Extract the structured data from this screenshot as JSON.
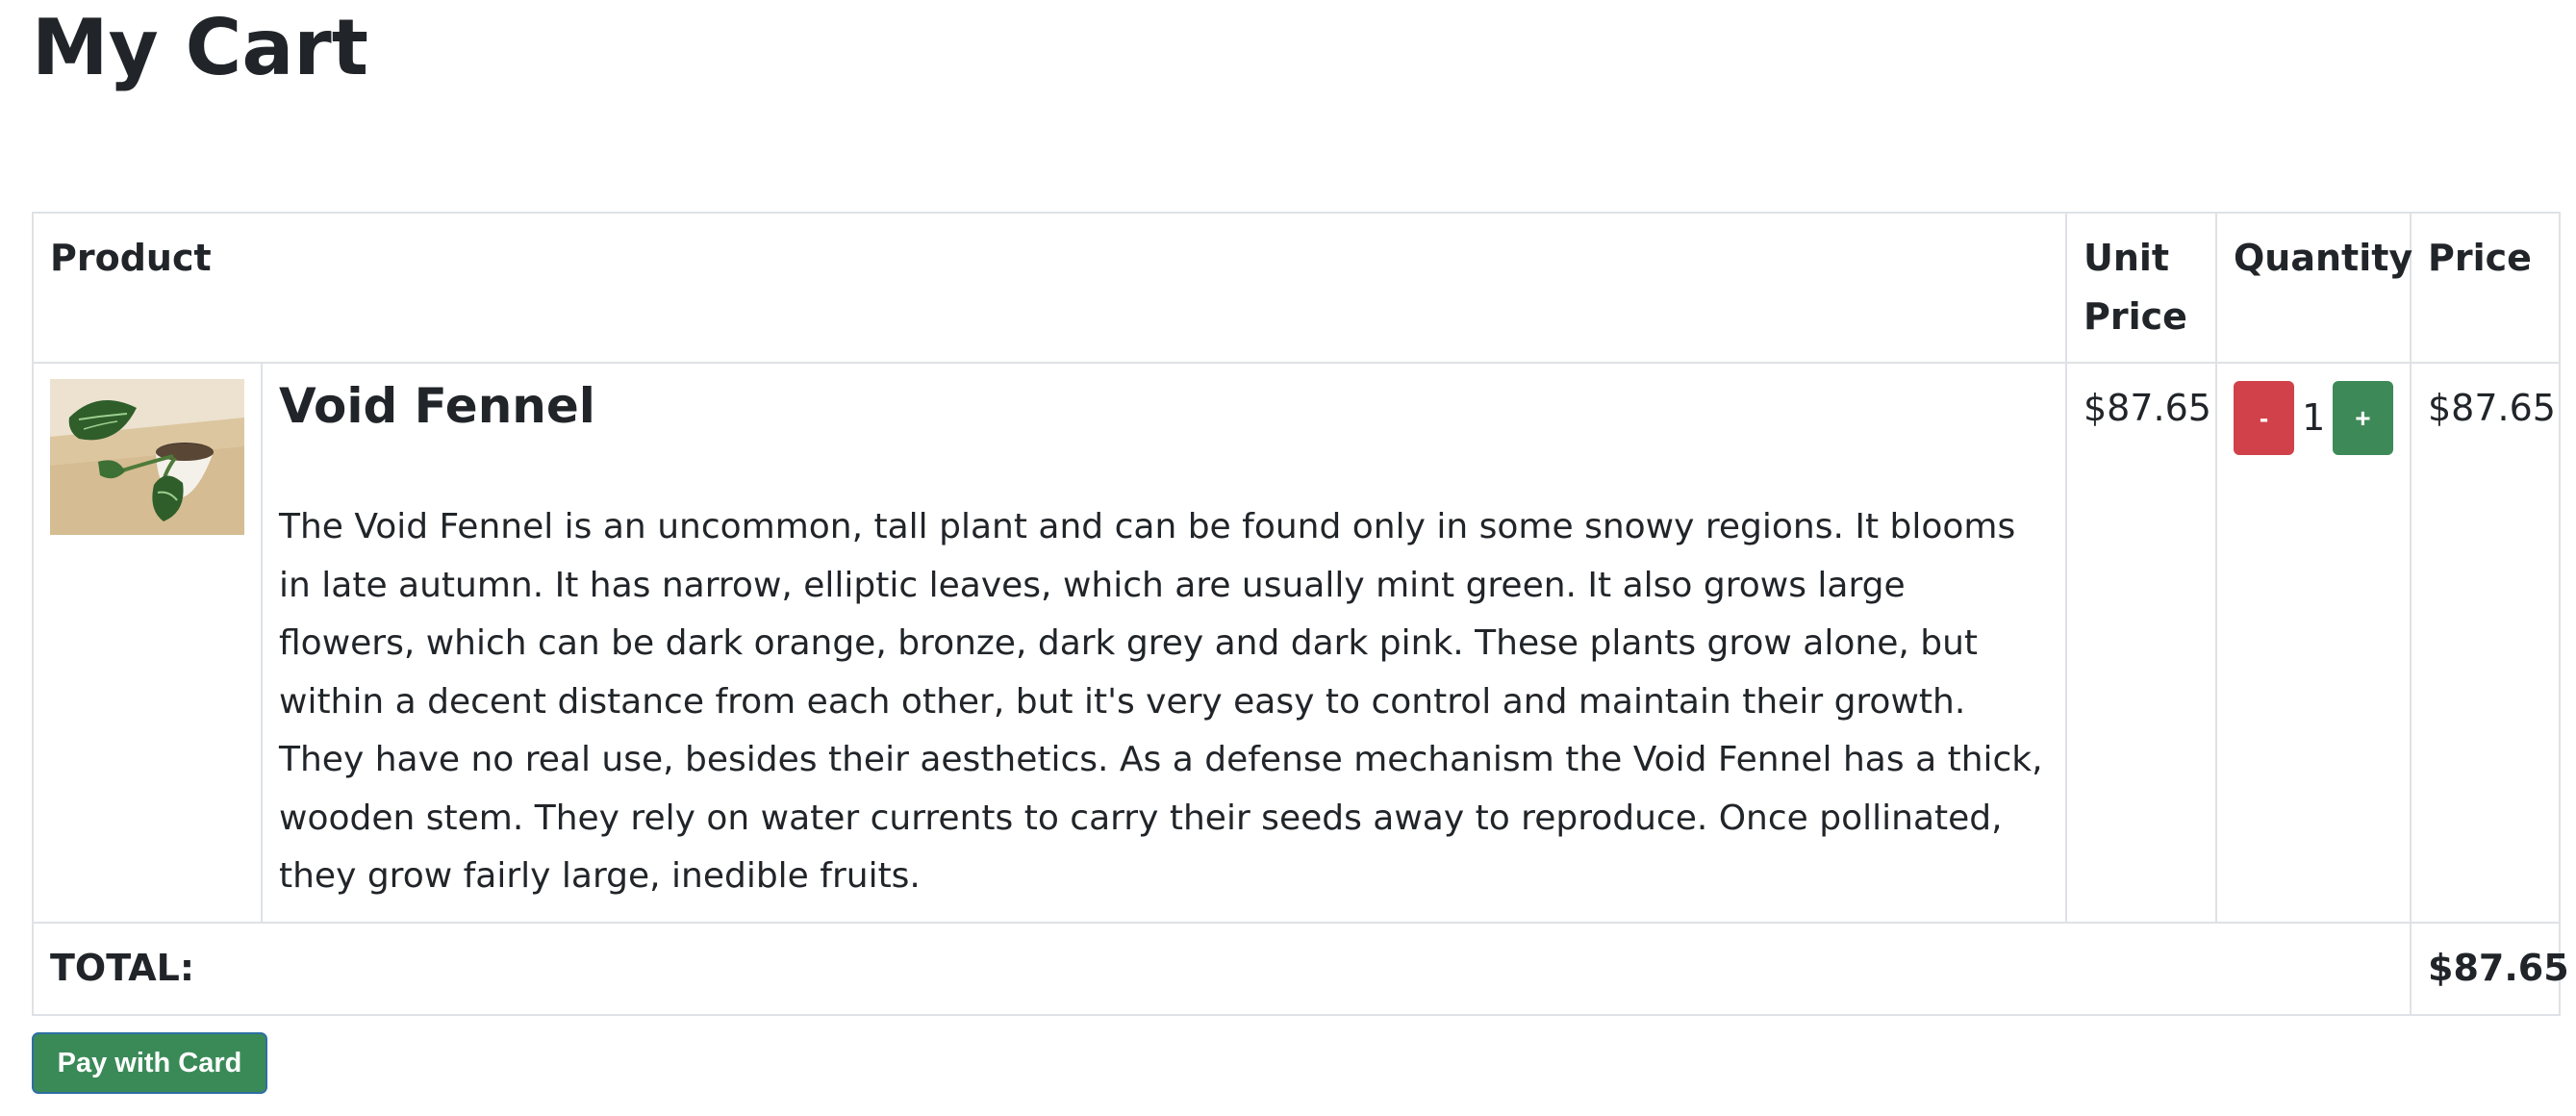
{
  "page": {
    "title": "My Cart"
  },
  "table": {
    "headers": {
      "product": "Product",
      "unit_price": "Unit Price",
      "quantity": "Quantity",
      "price": "Price"
    }
  },
  "items": [
    {
      "name": "Void Fennel",
      "image_icon": "potted-plant-image",
      "description": "The Void Fennel is an uncommon, tall plant and can be found only in some snowy regions. It blooms in late autumn. It has narrow, elliptic leaves, which are usually mint green. It also grows large flowers, which can be dark orange, bronze, dark grey and dark pink. These plants grow alone, but within a decent distance from each other, but it's very easy to control and maintain their growth. They have no real use, besides their aesthetics. As a defense mechanism the Void Fennel has a thick, wooden stem. They rely on water currents to carry their seeds away to reproduce. Once pollinated, they grow fairly large, inedible fruits.",
      "unit_price": "$87.65",
      "quantity": "1",
      "decrease_label": "-",
      "increase_label": "+",
      "price": "$87.65"
    }
  ],
  "footer": {
    "total_label": "TOTAL:",
    "total_value": "$87.65"
  },
  "actions": {
    "pay_label": "Pay with Card"
  },
  "colors": {
    "decrease_button": "#d1414a",
    "increase_button": "#3d8a58",
    "pay_button": "#3a8a58",
    "border": "#dee2e6",
    "text": "#212529"
  }
}
